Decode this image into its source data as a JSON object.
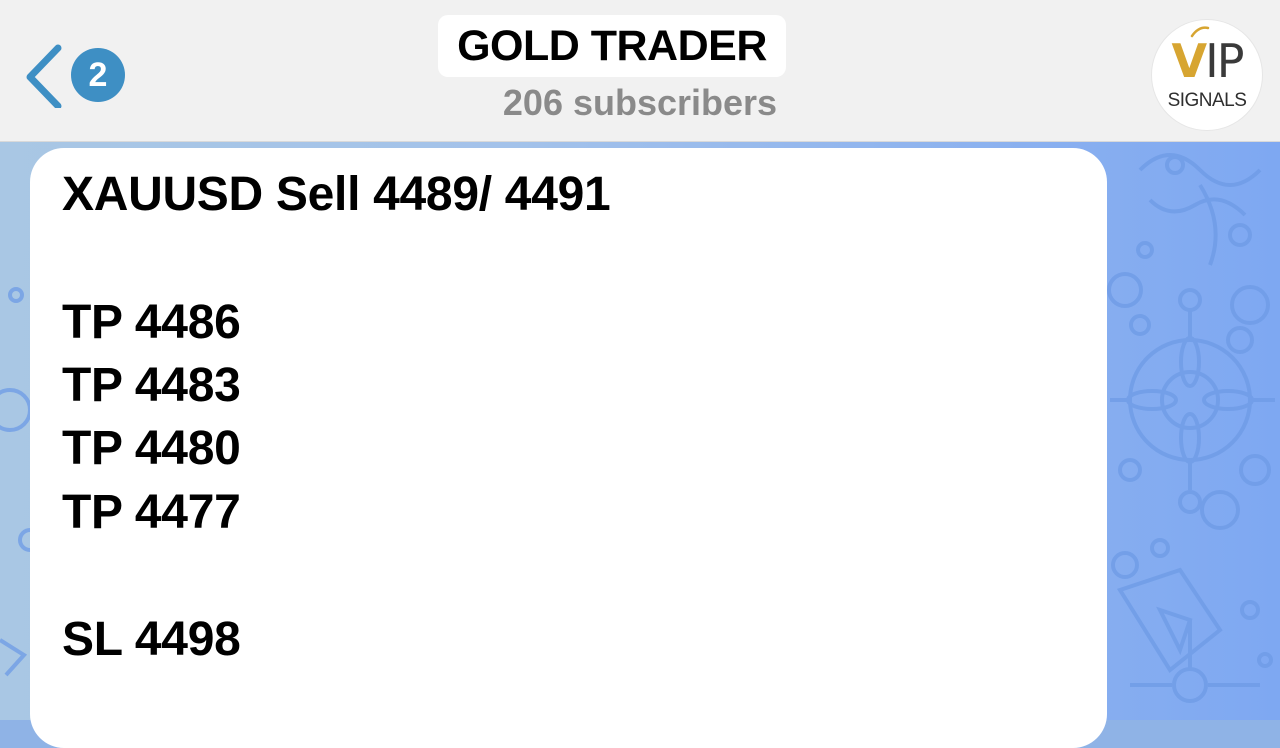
{
  "header": {
    "back_count": "2",
    "channel_title": "GOLD TRADER",
    "subscribers": "206 subscribers",
    "avatar": {
      "logo_vip": "VIP",
      "logo_signals": "SIGNALS"
    }
  },
  "message": {
    "lines": [
      "XAUUSD Sell 4489/ 4491",
      "TP 4486",
      "TP 4483",
      "TP 4480",
      "TP 4477",
      "SL 4498"
    ]
  },
  "colors": {
    "badge": "#3e8fc4",
    "back_chevron": "#3e8fc4",
    "logo_gold": "#d7a531"
  }
}
